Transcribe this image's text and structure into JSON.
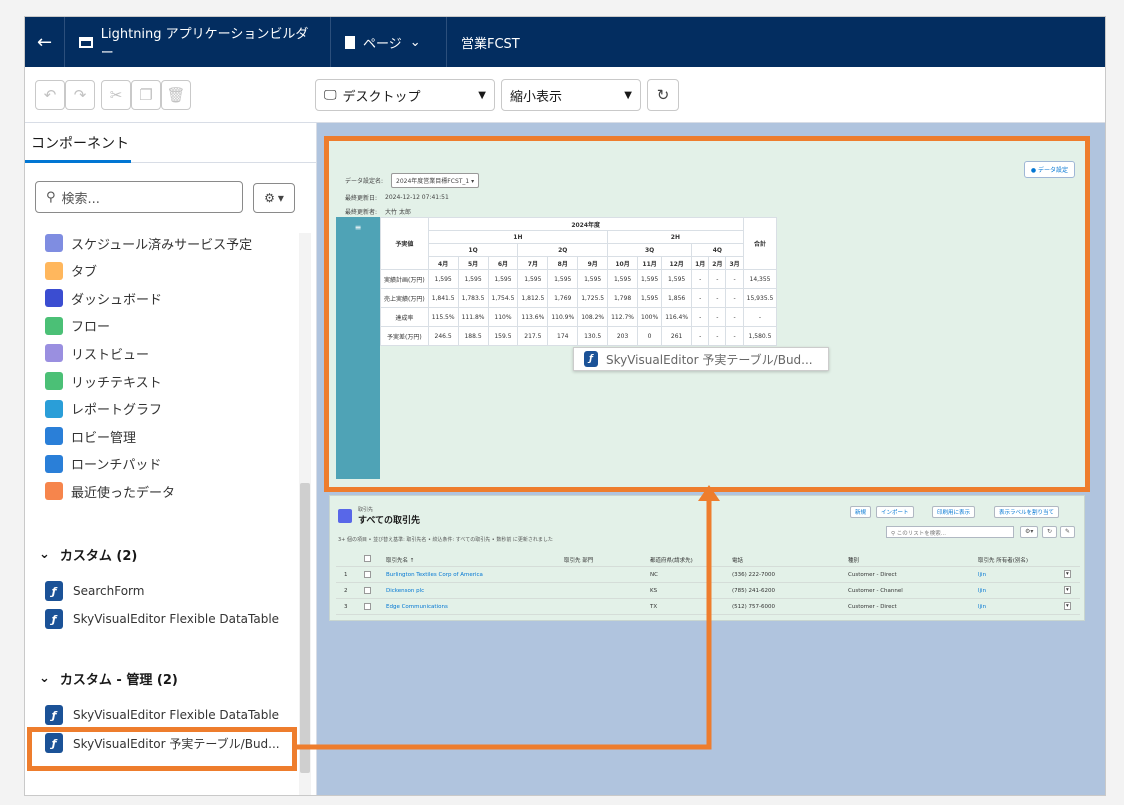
{
  "topbar": {
    "back_icon": "arrow-left",
    "builder_title": "Lightning アプリケーションビルダー",
    "page_label": "ページ",
    "page_name": "営業FCST"
  },
  "toolbar": {
    "device_label": "デスクトップ",
    "view_label": "縮小表示"
  },
  "left_panel": {
    "tab_label": "コンポーネント",
    "search_placeholder": "検索...",
    "standard_items": [
      {
        "label": "スケジュール済みサービス予定",
        "color": "#7f8de1"
      },
      {
        "label": "タブ",
        "color": "#ffb75d"
      },
      {
        "label": "ダッシュボード",
        "color": "#3b4dd1"
      },
      {
        "label": "フロー",
        "color": "#4bc076"
      },
      {
        "label": "リストビュー",
        "color": "#9a8fe0"
      },
      {
        "label": "リッチテキスト",
        "color": "#4bc076"
      },
      {
        "label": "レポートグラフ",
        "color": "#2a9ed8"
      },
      {
        "label": "ロビー管理",
        "color": "#2a7fd8"
      },
      {
        "label": "ローンチパッド",
        "color": "#2a7fd8"
      },
      {
        "label": "最近使ったデータ",
        "color": "#f6854c"
      }
    ],
    "custom_section": {
      "title": "カスタム (2)",
      "items": [
        "SearchForm",
        "SkyVisualEditor Flexible DataTable"
      ]
    },
    "managed_section": {
      "title": "カスタム - 管理 (2)",
      "items": [
        "SkyVisualEditor Flexible DataTable",
        "SkyVisualEditor 予実テーブル/Bud..."
      ]
    }
  },
  "canvas": {
    "filter": {
      "label1": "データ設定名:",
      "value1": "2024年度営業目標FCST_1",
      "label2": "最終更新日:",
      "value2": "2024-12-12 07:41:51",
      "label3": "最終更新者:",
      "value3": "大竹 太郎",
      "setting_button": "データ設定"
    },
    "menu_icon": "≡",
    "table": {
      "row_header": "予実値",
      "year": "2024年度",
      "halves": [
        "1H",
        "2H"
      ],
      "quarters": [
        "1Q",
        "2Q",
        "3Q",
        "4Q"
      ],
      "months": [
        "4月",
        "5月",
        "6月",
        "7月",
        "8月",
        "9月",
        "10月",
        "11月",
        "12月",
        "1月",
        "2月",
        "3月"
      ],
      "total_label": "合計",
      "rows": [
        {
          "label": "実績計画(万円)",
          "cells": [
            "1,595",
            "1,595",
            "1,595",
            "1,595",
            "1,595",
            "1,595",
            "1,595",
            "1,595",
            "1,595",
            "-",
            "-",
            "-",
            "14,355"
          ]
        },
        {
          "label": "売上実績(万円)",
          "cells": [
            "1,841.5",
            "1,783.5",
            "1,754.5",
            "1,812.5",
            "1,769",
            "1,725.5",
            "1,798",
            "1,595",
            "1,856",
            "-",
            "-",
            "-",
            "15,935.5"
          ]
        },
        {
          "label": "達成率",
          "cells": [
            "115.5%",
            "111.8%",
            "110%",
            "113.6%",
            "110.9%",
            "108.2%",
            "112.7%",
            "100%",
            "116.4%",
            "-",
            "-",
            "-",
            "-"
          ]
        },
        {
          "label": "予実差(万円)",
          "cells": [
            "246.5",
            "188.5",
            "159.5",
            "217.5",
            "174",
            "130.5",
            "203",
            "0",
            "261",
            "-",
            "-",
            "-",
            "1,580.5"
          ]
        }
      ]
    },
    "tooltip": "SkyVisualEditor 予実テーブル/Bud...",
    "listview": {
      "object": "取引先",
      "title": "すべての取引先",
      "info": "3+ 個の項目 • 並び替え基準: 取引先名 • 絞込条件: すべての取引先 • 数秒前 に更新されました",
      "buttons": [
        "新規",
        "インポート",
        "印刷用に表示",
        "表示ラベルを割り当て"
      ],
      "search_placeholder": "このリストを検索...",
      "columns": [
        "取引先名 ↑",
        "取引先 部門",
        "都道府県(請求先)",
        "電話",
        "種別",
        "取引先 所有者(別名)"
      ],
      "rows": [
        {
          "num": "1",
          "name": "Burlington Textiles Corp of America",
          "state": "NC",
          "phone": "(336) 222-7000",
          "type": "Customer - Direct",
          "owner": "ljin"
        },
        {
          "num": "2",
          "name": "Dickenson plc",
          "state": "KS",
          "phone": "(785) 241-6200",
          "type": "Customer - Channel",
          "owner": "ljin"
        },
        {
          "num": "3",
          "name": "Edge Communications",
          "state": "TX",
          "phone": "(512) 757-6000",
          "type": "Customer - Direct",
          "owner": "ljin"
        }
      ]
    }
  },
  "colors": {
    "header": "#032d60",
    "highlight": "#ee7d2d",
    "canvas": "#b0c4de",
    "component": "#e3f1e8"
  }
}
